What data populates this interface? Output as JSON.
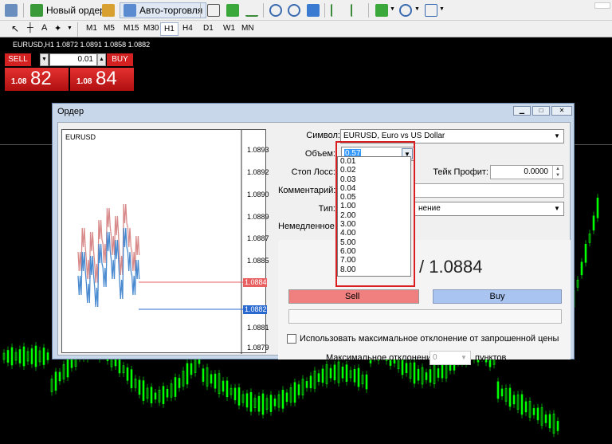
{
  "toolbar": {
    "new_order": "Новый ордер",
    "auto_trading": "Авто-торговля",
    "timeframes": [
      "M1",
      "M5",
      "M15",
      "M30",
      "H1",
      "H4",
      "D1",
      "W1",
      "MN"
    ],
    "active_timeframe": "H1"
  },
  "chart_header": "EURUSD,H1  1.0872 1.0891 1.0858 1.0882",
  "one_click": {
    "sell_label": "SELL",
    "buy_label": "BUY",
    "lot": "0.01",
    "sell_prefix": "1.08",
    "sell_big": "82",
    "buy_prefix": "1.08",
    "buy_big": "84"
  },
  "dialog": {
    "title": "Ордер",
    "mini_chart": {
      "symbol": "EURUSD",
      "axis": [
        "1.0893",
        "1.0892",
        "1.0890",
        "1.0889",
        "1.0887",
        "1.0885",
        "1.0884",
        "1.0882",
        "1.0881",
        "1.0879"
      ],
      "ask_tag": "1.0884",
      "bid_tag": "1.0882"
    },
    "symbol_label": "Символ:",
    "symbol_value": "EURUSD, Euro vs US Dollar",
    "volume_label": "Объем:",
    "volume_value": "0.57",
    "sl_label": "Стоп Лосс:",
    "tp_label": "Тейк Профит:",
    "tp_value": "0.0000",
    "comment_label": "Комментарий:",
    "type_label": "Тип:",
    "type_value": "нение",
    "exec_label": "Немедленное исп",
    "price_text": "/ 1.0884",
    "sell_btn_partial": "Sell",
    "buy_btn": "Buy",
    "deviation_check_label": "Использовать максимальное отклонение от запрошенной цены",
    "deviation_label": "Максимальное отклонение:",
    "deviation_value": "0",
    "deviation_unit": "пунктов",
    "volume_options": [
      "0.01",
      "0.02",
      "0.03",
      "0.04",
      "0.05",
      "1.00",
      "2.00",
      "3.00",
      "4.00",
      "5.00",
      "6.00",
      "7.00",
      "8.00"
    ]
  },
  "colors": {
    "sell_red": "#d32020",
    "buy_blue": "#a9c4f0",
    "candle_green": "#00ff00",
    "highlight_red": "#d81e1e"
  }
}
